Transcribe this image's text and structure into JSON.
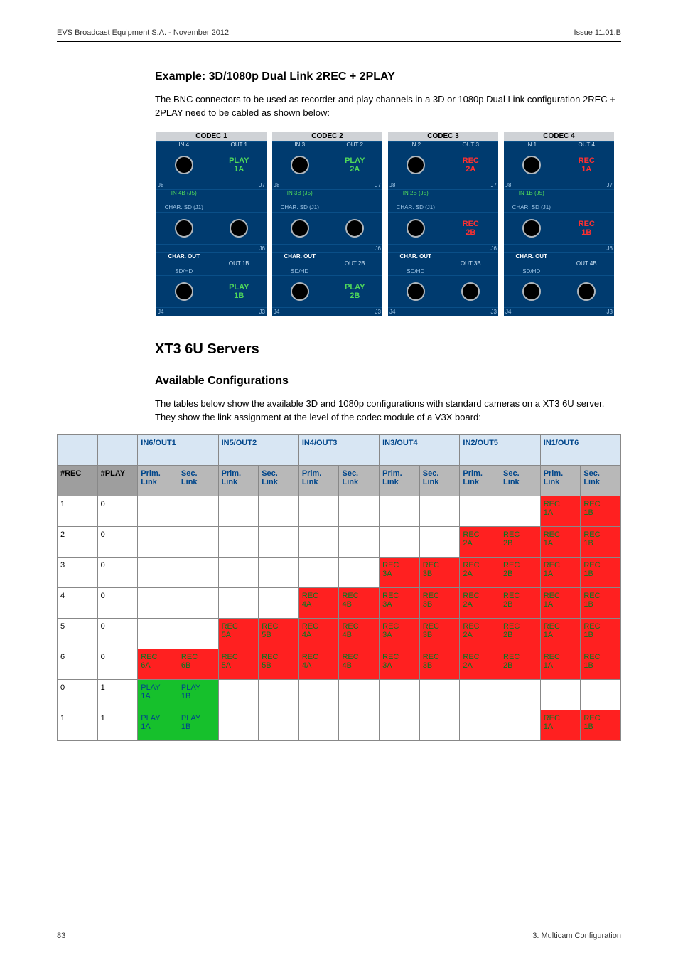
{
  "header": {
    "left": "EVS Broadcast Equipment S.A.  - November 2012",
    "right": "Issue 11.01.B"
  },
  "example": {
    "title": "Example: 3D/1080p Dual Link 2REC + 2PLAY",
    "intro": "The BNC connectors to be used as recorder and play channels in a 3D or 1080p Dual Link configuration 2REC + 2PLAY need to be cabled as shown below:"
  },
  "codec": {
    "modules": [
      {
        "title": "CODEC 1",
        "top": {
          "in": "IN 4",
          "out": "OUT 1",
          "chan": "PLAY 1A",
          "chanClass": "play"
        },
        "sub1": "IN 4B (J5)",
        "sub2": "CHAR. SD (J1)",
        "mid": {
          "left_label": "CHAR. OUT",
          "left_sub": "SD/HD",
          "right_label": "OUT 1B",
          "chan": "",
          "chanClass": ""
        },
        "bot": {
          "chan": "PLAY 1B",
          "chanClass": "play"
        }
      },
      {
        "title": "CODEC 2",
        "top": {
          "in": "IN 3",
          "out": "OUT 2",
          "chan": "PLAY 2A",
          "chanClass": "play"
        },
        "sub1": "IN 3B (J5)",
        "sub2": "CHAR. SD (J1)",
        "mid": {
          "left_label": "CHAR. OUT",
          "left_sub": "SD/HD",
          "right_label": "OUT 2B",
          "chan": "",
          "chanClass": ""
        },
        "bot": {
          "chan": "PLAY 2B",
          "chanClass": "play"
        }
      },
      {
        "title": "CODEC 3",
        "top": {
          "in": "IN 2",
          "out": "OUT 3",
          "chan": "REC 2A",
          "chanClass": "rec"
        },
        "sub1": "IN 2B (J5)",
        "sub2": "CHAR. SD (J1)",
        "mid": {
          "left_label": "CHAR. OUT",
          "left_sub": "SD/HD",
          "right_label": "OUT 3B",
          "chan": "REC 2B",
          "chanClass": "rec"
        },
        "bot": {
          "chan": "",
          "chanClass": ""
        }
      },
      {
        "title": "CODEC 4",
        "top": {
          "in": "IN 1",
          "out": "OUT 4",
          "chan": "REC 1A",
          "chanClass": "rec"
        },
        "sub1": "IN 1B (J5)",
        "sub2": "CHAR. SD (J1)",
        "mid": {
          "left_label": "CHAR. OUT",
          "left_sub": "SD/HD",
          "right_label": "OUT 4B",
          "chan": "REC 1B",
          "chanClass": "rec"
        },
        "bot": {
          "chan": "",
          "chanClass": ""
        }
      }
    ],
    "j_labels": {
      "j8": "J8",
      "j7": "J7",
      "j6": "J6",
      "j4": "J4",
      "j3": "J3"
    }
  },
  "xt3": {
    "title": "XT3 6U Servers",
    "subtitle": "Available Configurations",
    "intro": "The tables below show the available 3D and 1080p configurations with standard cameras on a XT3 6U server. They show the link assignment at the level of the codec module of a V3X board:"
  },
  "table": {
    "group_headers": [
      "",
      "",
      "IN6/OUT1",
      "IN5/OUT2",
      "IN4/OUT3",
      "IN3/OUT4",
      "IN2/OUT5",
      "IN1/OUT6"
    ],
    "sub_headers": [
      "#REC",
      "#PLAY",
      "Prim. Link",
      "Sec. Link",
      "Prim. Link",
      "Sec. Link",
      "Prim. Link",
      "Sec. Link",
      "Prim. Link",
      "Sec. Link",
      "Prim. Link",
      "Sec. Link",
      "Prim. Link",
      "Sec. Link"
    ],
    "rows": [
      {
        "rec": "1",
        "play": "0",
        "cells": [
          "",
          "",
          "",
          "",
          "",
          "",
          "",
          "",
          "",
          "",
          "REC 1A",
          "REC 1B"
        ],
        "classes": [
          "",
          "",
          "",
          "",
          "",
          "",
          "",
          "",
          "",
          "",
          "rec",
          "rec"
        ]
      },
      {
        "rec": "2",
        "play": "0",
        "cells": [
          "",
          "",
          "",
          "",
          "",
          "",
          "",
          "",
          "REC 2A",
          "REC 2B",
          "REC 1A",
          "REC 1B"
        ],
        "classes": [
          "",
          "",
          "",
          "",
          "",
          "",
          "",
          "",
          "rec",
          "rec",
          "rec",
          "rec"
        ]
      },
      {
        "rec": "3",
        "play": "0",
        "cells": [
          "",
          "",
          "",
          "",
          "",
          "",
          "REC 3A",
          "REC 3B",
          "REC 2A",
          "REC 2B",
          "REC 1A",
          "REC 1B"
        ],
        "classes": [
          "",
          "",
          "",
          "",
          "",
          "",
          "rec",
          "rec",
          "rec",
          "rec",
          "rec",
          "rec"
        ]
      },
      {
        "rec": "4",
        "play": "0",
        "cells": [
          "",
          "",
          "",
          "",
          "REC 4A",
          "REC 4B",
          "REC 3A",
          "REC 3B",
          "REC 2A",
          "REC 2B",
          "REC 1A",
          "REC 1B"
        ],
        "classes": [
          "",
          "",
          "",
          "",
          "rec",
          "rec",
          "rec",
          "rec",
          "rec",
          "rec",
          "rec",
          "rec"
        ]
      },
      {
        "rec": "5",
        "play": "0",
        "cells": [
          "",
          "",
          "REC 5A",
          "REC 5B",
          "REC 4A",
          "REC 4B",
          "REC 3A",
          "REC 3B",
          "REC 2A",
          "REC 2B",
          "REC 1A",
          "REC 1B"
        ],
        "classes": [
          "",
          "",
          "rec",
          "rec",
          "rec",
          "rec",
          "rec",
          "rec",
          "rec",
          "rec",
          "rec",
          "rec"
        ]
      },
      {
        "rec": "6",
        "play": "0",
        "cells": [
          "REC 6A",
          "REC 6B",
          "REC 5A",
          "REC 5B",
          "REC 4A",
          "REC 4B",
          "REC 3A",
          "REC 3B",
          "REC 2A",
          "REC 2B",
          "REC 1A",
          "REC 1B"
        ],
        "classes": [
          "rec",
          "rec",
          "rec",
          "rec",
          "rec",
          "rec",
          "rec",
          "rec",
          "rec",
          "rec",
          "rec",
          "rec"
        ]
      },
      {
        "rec": "0",
        "play": "1",
        "cells": [
          "PLAY 1A",
          "PLAY 1B",
          "",
          "",
          "",
          "",
          "",
          "",
          "",
          "",
          "",
          ""
        ],
        "classes": [
          "play",
          "play",
          "",
          "",
          "",
          "",
          "",
          "",
          "",
          "",
          "",
          ""
        ]
      },
      {
        "rec": "1",
        "play": "1",
        "cells": [
          "PLAY 1A",
          "PLAY 1B",
          "",
          "",
          "",
          "",
          "",
          "",
          "",
          "",
          "REC 1A",
          "REC 1B"
        ],
        "classes": [
          "play",
          "play",
          "",
          "",
          "",
          "",
          "",
          "",
          "",
          "",
          "rec",
          "rec"
        ]
      }
    ]
  },
  "footer": {
    "left": "83",
    "right": "3. Multicam Configuration"
  }
}
